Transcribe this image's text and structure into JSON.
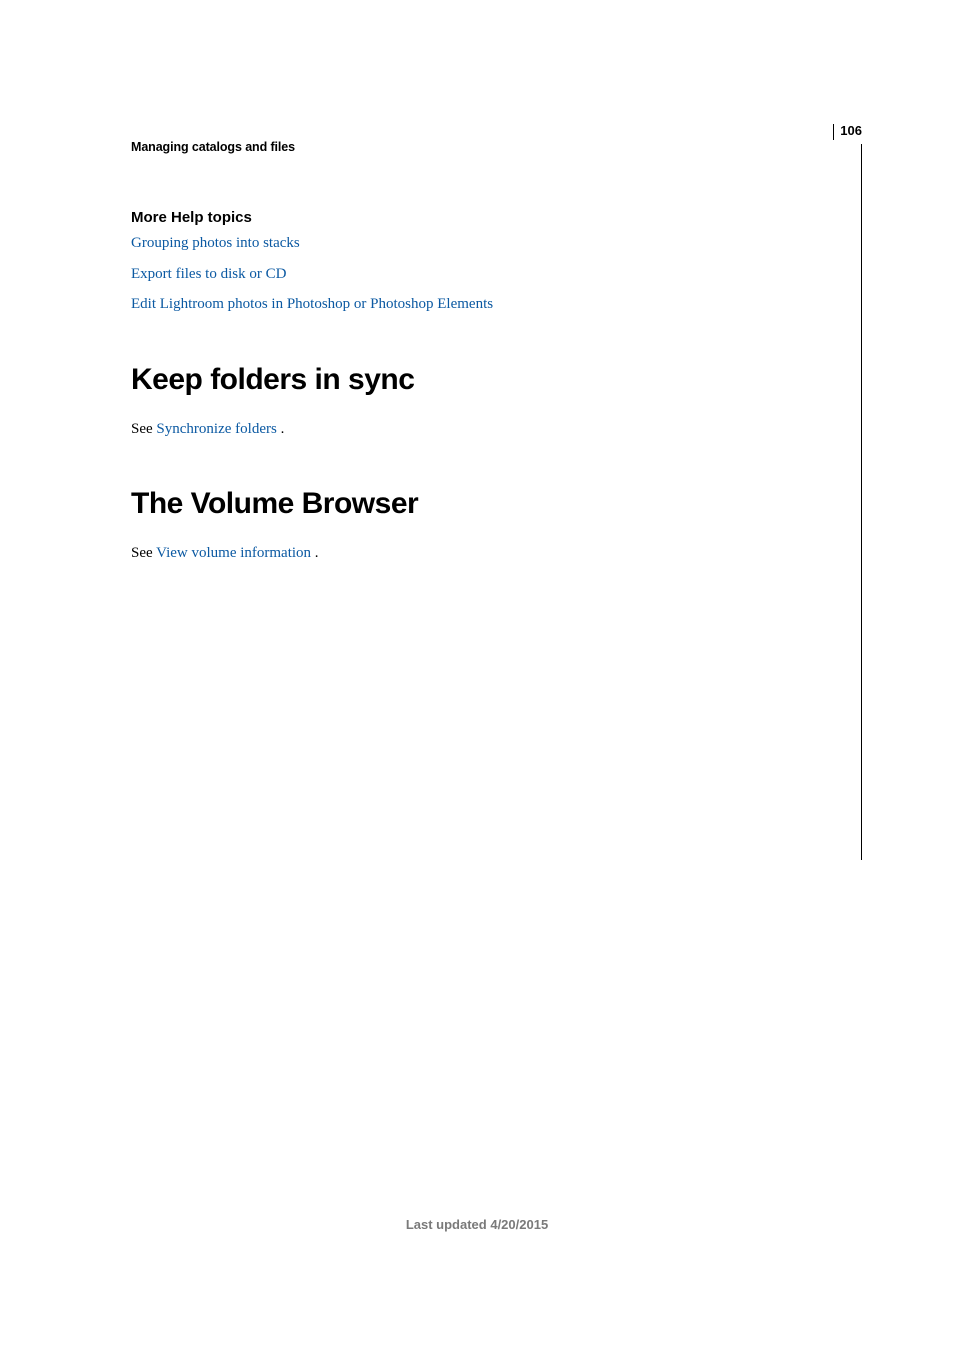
{
  "page_number": "106",
  "breadcrumb": "Managing catalogs and files",
  "more_help": {
    "label": "More Help topics",
    "links": [
      "Grouping photos into stacks",
      "Export files to disk or CD",
      "Edit Lightroom photos in Photoshop or Photoshop Elements"
    ]
  },
  "sections": [
    {
      "heading": "Keep folders in sync",
      "see_prefix": "See ",
      "see_link": "Synchronize folders",
      "see_suffix": " ."
    },
    {
      "heading": "The Volume Browser",
      "see_prefix": "See ",
      "see_link": "View volume information",
      "see_suffix": " ."
    }
  ],
  "footer": "Last updated 4/20/2015"
}
